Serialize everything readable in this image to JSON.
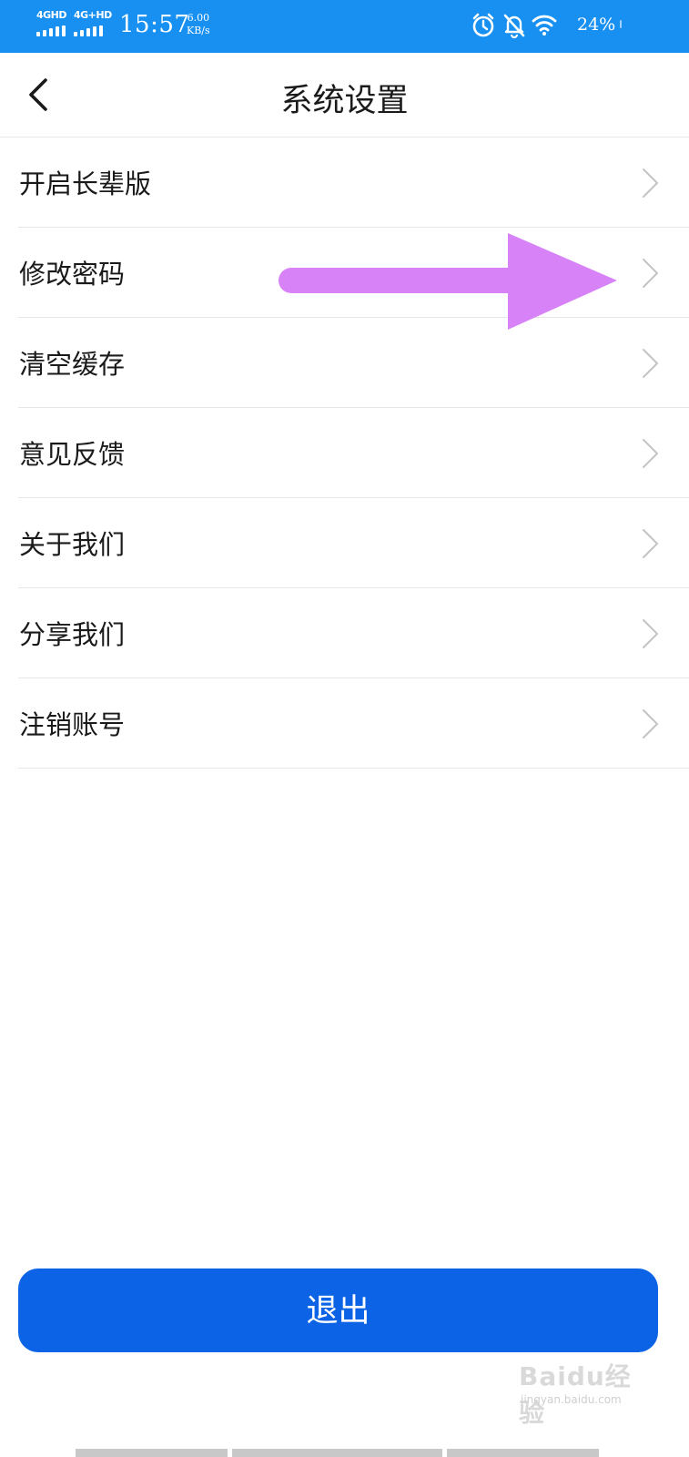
{
  "status_bar": {
    "network_1": "4GHD",
    "network_2": "4G+HD",
    "time": "15:57",
    "speed_value": "6.00",
    "speed_unit": "KB/s",
    "battery": "24%",
    "icons": [
      "alarm-icon",
      "mute-bell-icon",
      "wifi-icon"
    ]
  },
  "header": {
    "title": "系统设置",
    "back_icon": "chevron-left-icon"
  },
  "settings": {
    "items": [
      {
        "label": "开启长辈版"
      },
      {
        "label": "修改密码"
      },
      {
        "label": "清空缓存"
      },
      {
        "label": "意见反馈"
      },
      {
        "label": "关于我们"
      },
      {
        "label": "分享我们"
      },
      {
        "label": "注销账号"
      }
    ],
    "chevron_icon": "chevron-right-icon"
  },
  "annotation": {
    "color": "#d783f7"
  },
  "logout": {
    "label": "退出",
    "color": "#0c63e6"
  },
  "watermark": {
    "brand": "Baidu经验",
    "url": "jingyan.baidu.com"
  },
  "colors": {
    "status_bar": "#1790f2",
    "divider": "#e6e6e6"
  }
}
